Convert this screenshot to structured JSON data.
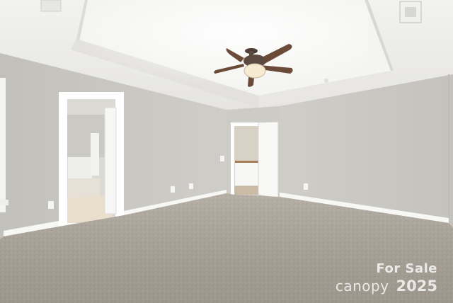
{
  "watermark": {
    "line1": "For Sale",
    "brand": "canopy",
    "year": "2025"
  },
  "colors": {
    "ceiling": "#efefed",
    "wall": "#c9c7c2",
    "carpet": "#aca59b",
    "trim": "#ffffff",
    "fan_blade": "#6b4a38"
  }
}
